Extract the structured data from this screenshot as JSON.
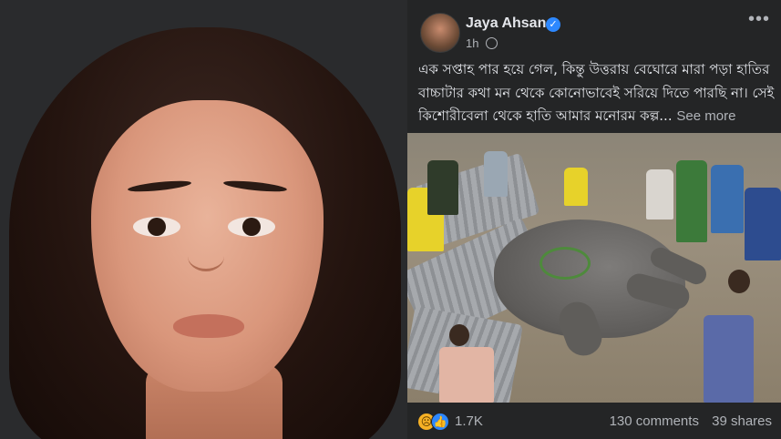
{
  "post": {
    "author": "Jaya Ahsan",
    "time": "1h",
    "body": "এক সপ্তাহ পার হয়ে গেল, কিন্তু উত্তরায় বেঘোরে মারা পড়া হাতির বাচ্চাটার কথা মন থেকে কোনোভাবেই সরিয়ে দিতে পারছি না। সেই কিশোরীবেলা থেকে হাতি আমার মনোরম কল্প...",
    "see_more": "See more",
    "reaction_count": "1.7K",
    "comments": "130 comments",
    "shares": "39 shares"
  },
  "icons": {
    "verified": "verified-badge-icon",
    "globe": "globe-icon",
    "more": "more-options-icon",
    "sad": "sad-reaction-icon",
    "like": "like-reaction-icon"
  },
  "colors": {
    "background": "#242526",
    "text": "#e4e6eb",
    "secondary_text": "#b0b3b8",
    "verified": "#2d88ff"
  }
}
